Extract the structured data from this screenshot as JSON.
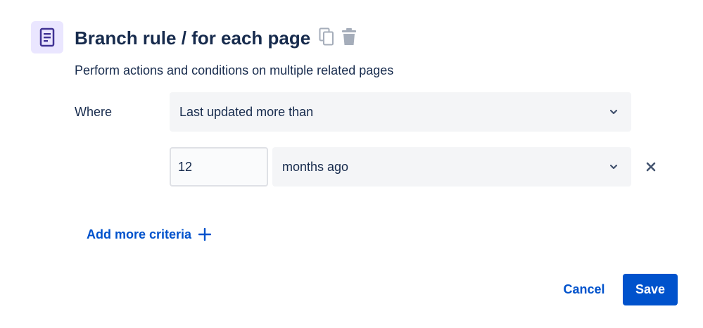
{
  "rule": {
    "icon": "page-icon",
    "title": "Branch rule / for each page",
    "description": "Perform actions and conditions on multiple related pages",
    "copy_icon": "copy-icon",
    "delete_icon": "trash-icon"
  },
  "criteria": {
    "where_label": "Where",
    "condition": {
      "selected": "Last updated more than",
      "icon": "chevron-down-icon"
    },
    "amount": {
      "value": "12"
    },
    "unit": {
      "selected": "months ago",
      "icon": "chevron-down-icon"
    },
    "remove_icon": "close-icon"
  },
  "add_criteria": {
    "label": "Add more criteria",
    "icon": "plus-icon"
  },
  "footer": {
    "cancel_label": "Cancel",
    "save_label": "Save"
  },
  "colors": {
    "primary": "#0052cc",
    "text": "#172b4d",
    "icon_bg": "#eae6ff",
    "icon_fg": "#403294",
    "field_bg": "#f4f5f7",
    "muted_icon": "#a5adba"
  }
}
